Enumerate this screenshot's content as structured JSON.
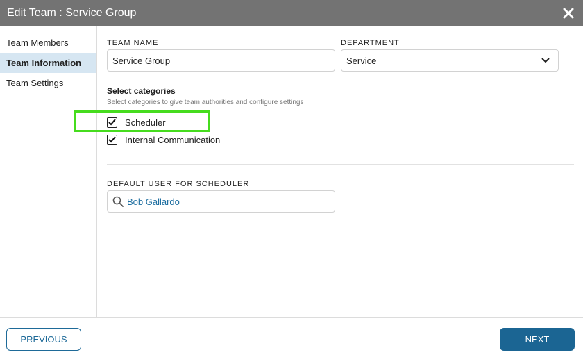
{
  "window": {
    "title": "Edit Team : Service Group",
    "close_icon": "close-icon"
  },
  "sidebar": {
    "items": [
      {
        "label": "Team Members",
        "active": false
      },
      {
        "label": "Team Information",
        "active": true
      },
      {
        "label": "Team Settings",
        "active": false
      }
    ]
  },
  "form": {
    "team_name_label": "TEAM NAME",
    "team_name_value": "Service Group",
    "department_label": "DEPARTMENT",
    "department_value": "Service",
    "categories_title": "Select categories",
    "categories_desc": "Select categories to give team authorities and configure settings",
    "categories": [
      {
        "label": "Scheduler",
        "checked": true
      },
      {
        "label": "Internal Communication",
        "checked": true
      }
    ],
    "default_user_label": "DEFAULT USER FOR SCHEDULER",
    "default_user_value": "Bob Gallardo"
  },
  "footer": {
    "previous_label": "PREVIOUS",
    "next_label": "NEXT"
  },
  "colors": {
    "titlebar": "#737373",
    "active_tab": "#d6e6f2",
    "primary": "#1b6593",
    "highlight": "#46dc1e",
    "link": "#1f6fa1"
  }
}
